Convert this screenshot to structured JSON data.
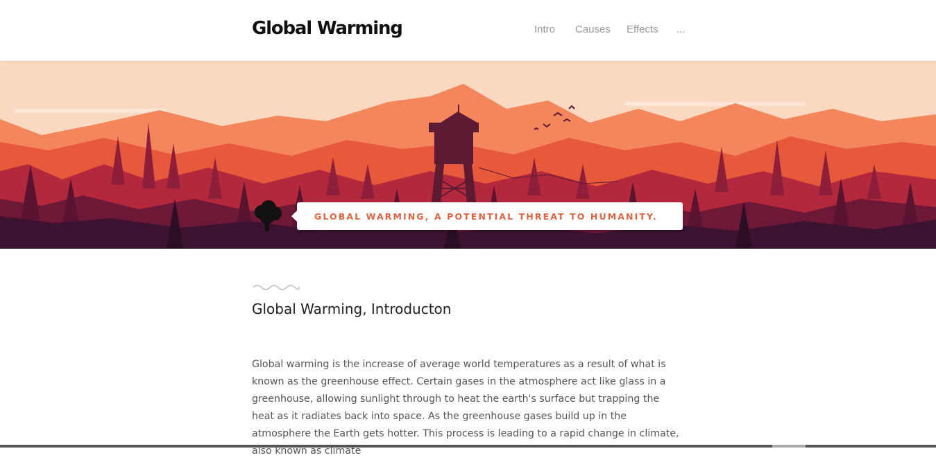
{
  "header": {
    "brand": "Global Warming",
    "nav": [
      {
        "label": "Intro"
      },
      {
        "label": "Causes"
      },
      {
        "label": "Effects"
      },
      {
        "label": "..."
      }
    ]
  },
  "hero": {
    "tagline": "GLOBAL WARMING, A POTENTIAL THREAT TO HUMANITY.",
    "badge_icon": "tree-icon",
    "colors": {
      "sky": "#fbd9c1",
      "accent": "#e2633f",
      "far_mountains": "#f4865c",
      "mid_mountains": "#e8583a",
      "near_forest": "#b3283a",
      "dark_forest": "#6e1838",
      "darkest_forest": "#3b1230"
    }
  },
  "main": {
    "title": "Global Warming, Introducton",
    "paragraph": "Global warming is the increase of average world temperatures as a result of what is known as the greenhouse effect. Certain gases in the atmosphere act like glass in a greenhouse, allowing sunlight through to heat the earth's surface but trapping the heat as it radiates back into space. As the greenhouse gases build up in the atmosphere the Earth gets hotter. This process is leading to a rapid change in climate, also known as climate"
  }
}
